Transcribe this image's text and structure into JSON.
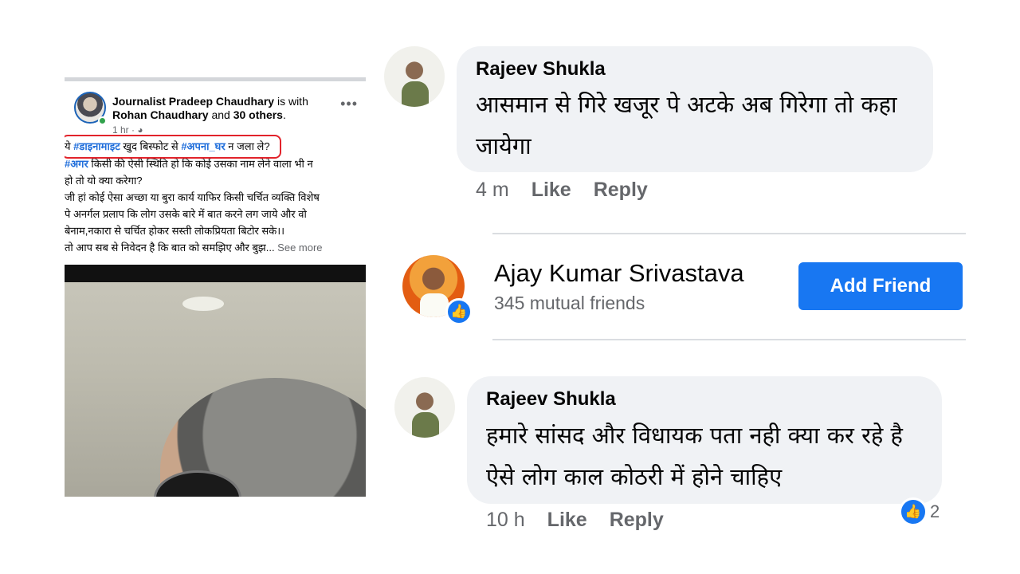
{
  "post": {
    "author": "Journalist Pradeep Chaudhary",
    "with_text": " is with",
    "tagged": "Rohan Chaudhary",
    "and_text": " and ",
    "others": "30 others",
    "period": ".",
    "time": "1 hr · ",
    "privacy_icon": "globe-icon",
    "more_icon": "•••",
    "highlight_color": "#e2232b",
    "line1_prefix": "ये ",
    "line1_tag1": "#डाइनामाइट",
    "line1_mid": " खुद बिस्फोट से ",
    "line1_tag2": "#अपना_घर",
    "line1_suffix": " न जला ले?",
    "line2_tag": "#अगर",
    "line2_text": " किसी की ऐसी स्थिति हो कि कोई उसका नाम लेने वाला भी न",
    "line3": "हो तो यो क्या करेगा?",
    "line4": "जी हां कोई ऐसा अच्छा या बुरा कार्य याफिर किसी चर्चित व्यक्ति विशेष",
    "line5": "पे अनर्गल प्रलाप कि लोग उसके बारे में बात करने लग जाये और वो",
    "line6": "बेनाम,नकारा से चर्चित होकर सस्ती लोकप्रियता बिटोर सके।।",
    "line7": "तो आप सब से निवेदन है कि बात को समझिए और बुझ... ",
    "see_more": "See more"
  },
  "comment1": {
    "name": "Rajeev Shukla",
    "text_line1": "आसमान से गिरे खजूर पे अटके अब गिरेगा तो कहा",
    "text_line2": "जायेगा",
    "time": "4 m",
    "like": "Like",
    "reply": "Reply"
  },
  "friend": {
    "name": "Ajay Kumar Srivastava",
    "mutual": "345 mutual friends",
    "button": "Add Friend",
    "badge_icon": "👍"
  },
  "comment2": {
    "name": "Rajeev Shukla",
    "text_line1": "हमारे सांसद और विधायक पता नही क्या कर रहे है",
    "text_line2": "ऐसे लोग काल कोठरी में होने चाहिए",
    "time": "10 h",
    "like": "Like",
    "reply": "Reply",
    "reaction_icon": "👍",
    "reaction_count": "2"
  },
  "colors": {
    "accent": "#1877f2",
    "hashtag": "#216fdb",
    "secondary_text": "#65676b",
    "bubble": "#f0f2f5"
  }
}
